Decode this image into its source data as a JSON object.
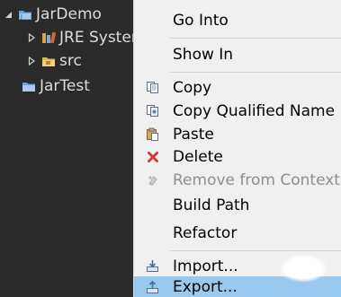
{
  "tree": {
    "root": {
      "label": "JarDemo",
      "icon": "java-project-icon",
      "expanded": true
    },
    "children": [
      {
        "label": "JRE System Library",
        "icon": "library-icon"
      },
      {
        "label": "src",
        "icon": "package-folder-icon"
      }
    ],
    "sibling": {
      "label": "JarTest",
      "icon": "project-folder-icon"
    }
  },
  "context_menu": {
    "items": [
      {
        "label": "Go Into"
      },
      {
        "label": "Show In"
      },
      {
        "label": "Copy",
        "icon": "copy-icon"
      },
      {
        "label": "Copy Qualified Name",
        "icon": "copy-qualified-name-icon"
      },
      {
        "label": "Paste",
        "icon": "paste-icon"
      },
      {
        "label": "Delete",
        "icon": "delete-icon"
      },
      {
        "label": "Remove from Context",
        "icon": "remove-from-context-icon",
        "disabled": true
      },
      {
        "label": "Build Path"
      },
      {
        "label": "Refactor"
      },
      {
        "label": "Import...",
        "icon": "import-icon"
      },
      {
        "label": "Export...",
        "icon": "export-icon",
        "selected": true
      }
    ]
  },
  "colors": {
    "tree_background": "#2b2b2b",
    "tree_text": "#dcdcdc",
    "menu_background": "#f0f0f0",
    "selected_background": "#99c9ef",
    "disabled_text": "#8f8f8f",
    "delete_icon": "#d23b3b"
  }
}
